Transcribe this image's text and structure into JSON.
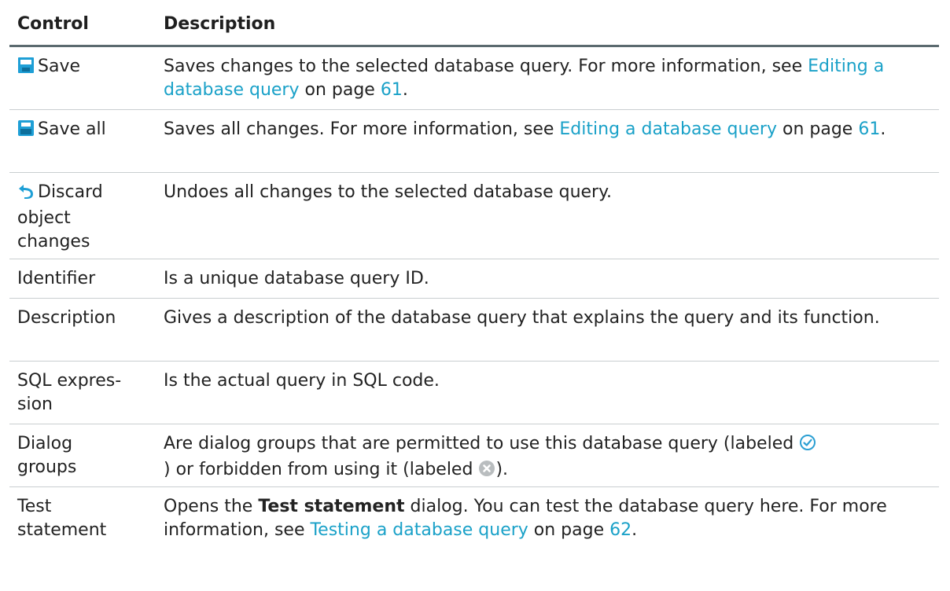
{
  "table": {
    "header": {
      "control": "Control",
      "description": "Description"
    },
    "rows": [
      {
        "control": "Save",
        "icon": "save-icon",
        "desc_text": "Saves changes to the selected database query. For more information, see ",
        "link": "Editing a database query",
        "desc_mid": " on page ",
        "page": "61",
        "desc_end": "."
      },
      {
        "control": "Save all",
        "icon": "save-all-icon",
        "desc_text": "Saves all changes. For more information, see ",
        "link": "Editing a database query",
        "desc_mid": " on page ",
        "page": "61",
        "desc_end": "."
      },
      {
        "control": "Discard object changes",
        "control_lines": [
          "Discard",
          "object",
          "changes"
        ],
        "icon": "undo-icon",
        "desc_text": "Undoes all changes to the selected database query."
      },
      {
        "control": "Identifier",
        "desc_text": "Is a unique database query ID."
      },
      {
        "control": "Description",
        "desc_text": "Gives a description of the database query that explains the query and its function."
      },
      {
        "control_lines": [
          "SQL expres-",
          "sion"
        ],
        "desc_text": "Is the actual query in SQL code."
      },
      {
        "control_lines": [
          "Dialog",
          "groups"
        ],
        "desc_part1": "Are dialog groups that are permitted to use this database query (labeled ",
        "permitted_icon": "check-circle-icon",
        "desc_part2": ") or forbidden from using it (labeled ",
        "forbidden_icon": "x-circle-icon",
        "desc_part3": ")."
      },
      {
        "control_lines": [
          "Test",
          "statement"
        ],
        "desc_part1": "Opens the ",
        "bold_text": "Test statement",
        "desc_part2": " dialog. You can test the database query here. For more information, see ",
        "link": "Testing a database query",
        "desc_mid": " on page ",
        "page": "62",
        "desc_end": "."
      }
    ]
  },
  "colors": {
    "link": "#1aa1c8",
    "icon_blue": "#1e9fd6",
    "header_rule": "#5b6a6f",
    "row_rule": "#c9ced0",
    "check_green": "#2b9fd3",
    "x_gray": "#b9bdbf"
  }
}
